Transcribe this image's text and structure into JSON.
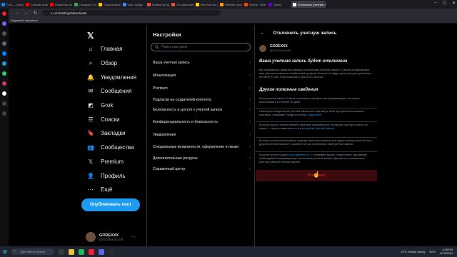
{
  "browser": {
    "tabs": [
      {
        "label": "Foto — Бесплатн",
        "color": "#0a84ff"
      },
      {
        "label": "Channel analytics",
        "color": "#ff0000"
      },
      {
        "label": "Payments info",
        "color": "#ff0000"
      },
      {
        "label": "Справка | Enter",
        "color": "#34a853"
      },
      {
        "label": "Серьезный кон",
        "color": "#ffcc00"
      },
      {
        "label": "соус трейд - G",
        "color": "#4285f4"
      },
      {
        "label": "Конвертер врем",
        "color": "#e94b3c"
      },
      {
        "label": "Он-лайн времен",
        "color": "#e94b3c"
      },
      {
        "label": "Желтый экз |",
        "color": "#ffd400"
      },
      {
        "label": "Рейтинг лучш",
        "color": "#ff9800"
      },
      {
        "label": "Reddit - Dive int",
        "color": "#ff4500"
      },
      {
        "label": "Yahoo",
        "color": "#6001d2"
      },
      {
        "label": "Отключить учетную зап",
        "color": "#ffffff",
        "active": true
      }
    ],
    "url": "x.com/settings/deactivate",
    "bookmark": "Вариант6 ключевое"
  },
  "nav": {
    "items": [
      {
        "label": "Главная",
        "icon": "home-icon"
      },
      {
        "label": "Обзор",
        "icon": "search-icon"
      },
      {
        "label": "Уведомления",
        "icon": "bell-icon"
      },
      {
        "label": "Сообщения",
        "icon": "mail-icon"
      },
      {
        "label": "Grok",
        "icon": "grok-icon"
      },
      {
        "label": "Списки",
        "icon": "list-icon"
      },
      {
        "label": "Закладки",
        "icon": "bookmark-icon"
      },
      {
        "label": "Сообщества",
        "icon": "people-icon"
      },
      {
        "label": "Premium",
        "icon": "x-icon"
      },
      {
        "label": "Профиль",
        "icon": "user-icon"
      },
      {
        "label": "Ещё",
        "icon": "more-icon"
      }
    ],
    "post_button": "Опубликовать пост",
    "account_name": "GODEXXX",
    "account_handle": "@GODexxXzzr5"
  },
  "settings": {
    "title": "Настройки",
    "search_placeholder": "Поиск настроек",
    "items": [
      "Ваша учетная запись",
      "Монетизация",
      "Premium",
      "Подписки на создателей контента",
      "Безопасность и доступ к учетной записи",
      "Конфиденциальность и безопасность",
      "Уведомления",
      "Специальные возможности, оформление и языки",
      "Дополнительные ресурсы",
      "Справочный центр"
    ]
  },
  "detail": {
    "title": "Отключить учетную запись",
    "account_name": "GODEXXX",
    "account_handle": "@GODexxXzzr5",
    "heading1": "Ваша учетная запись будет отключена",
    "para1": "Вы собираетесь запустить процесс отключения учетной записи X. Ваше отображаемое имя, имя пользователя и публичный профиль больше не будут доступны для просмотра на сайте X.com, в приложении X для iOS и Android.",
    "heading2": "Другие полезные сведения",
    "para2": "Если учетная запись X была отключена случайно или неправомерно, ее можно восстановить в течение 30 дней.",
    "para3a": "Некоторые сведения об учетной записи все еще могут быть доступны в поисковых системах, например Google или Bing.",
    "para3link": "Подробнее",
    "para4a": "Если вы просто хотите сменить свое имя пользователя, отключать учетную запись не нужно — просто измените его в",
    "para4link": "настройках учетной записи.",
    "para5": "Если вы хотите использовать текущее имя пользователя или адрес электронной почты в другой учетной записи X, измените их до отключения этой учетной записи.",
    "para6a": "Если вы хотите скачать",
    "para6link": "свои данные из X",
    "para6b": ", отправьте запрос и выполните скачивание необходимой информации до отключения учетной записи. Данные из отключенных учетных записей нельзя скачать.",
    "disable_button": "Отключить"
  },
  "taskbar": {
    "search": "Type here to search",
    "weather": "23°C  Mostly cloudy",
    "lang": "ENG",
    "time": "4:28 PM",
    "date": "5/19/2024"
  }
}
